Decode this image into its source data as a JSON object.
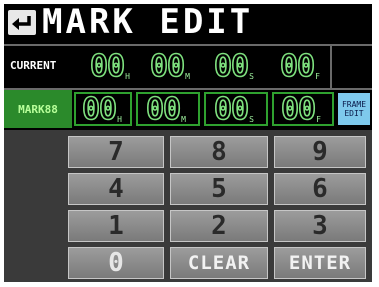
{
  "title": "MARK EDIT",
  "back_icon": "return-arrow-icon",
  "current": {
    "label": "CURRENT",
    "fields": [
      {
        "value": "00",
        "unit": "H"
      },
      {
        "value": "00",
        "unit": "M"
      },
      {
        "value": "00",
        "unit": "S"
      },
      {
        "value": "00",
        "unit": "F"
      }
    ]
  },
  "mark": {
    "label": "MARK88",
    "fields": [
      {
        "value": "00",
        "unit": "H"
      },
      {
        "value": "00",
        "unit": "M"
      },
      {
        "value": "00",
        "unit": "S"
      },
      {
        "value": "00",
        "unit": "F"
      }
    ],
    "frame_edit_label": "FRAME\nEDIT"
  },
  "keypad": {
    "k7": "7",
    "k8": "8",
    "k9": "9",
    "k4": "4",
    "k5": "5",
    "k6": "6",
    "k1": "1",
    "k2": "2",
    "k3": "3",
    "k0": "0",
    "clear": "CLEAR",
    "enter": "ENTER"
  },
  "colors": {
    "digit_green": "#7ee07e",
    "mark_label_bg": "#2b8a2b",
    "frame_edit_bg": "#7ec9ec",
    "key_gray": "#8a8a8a"
  }
}
